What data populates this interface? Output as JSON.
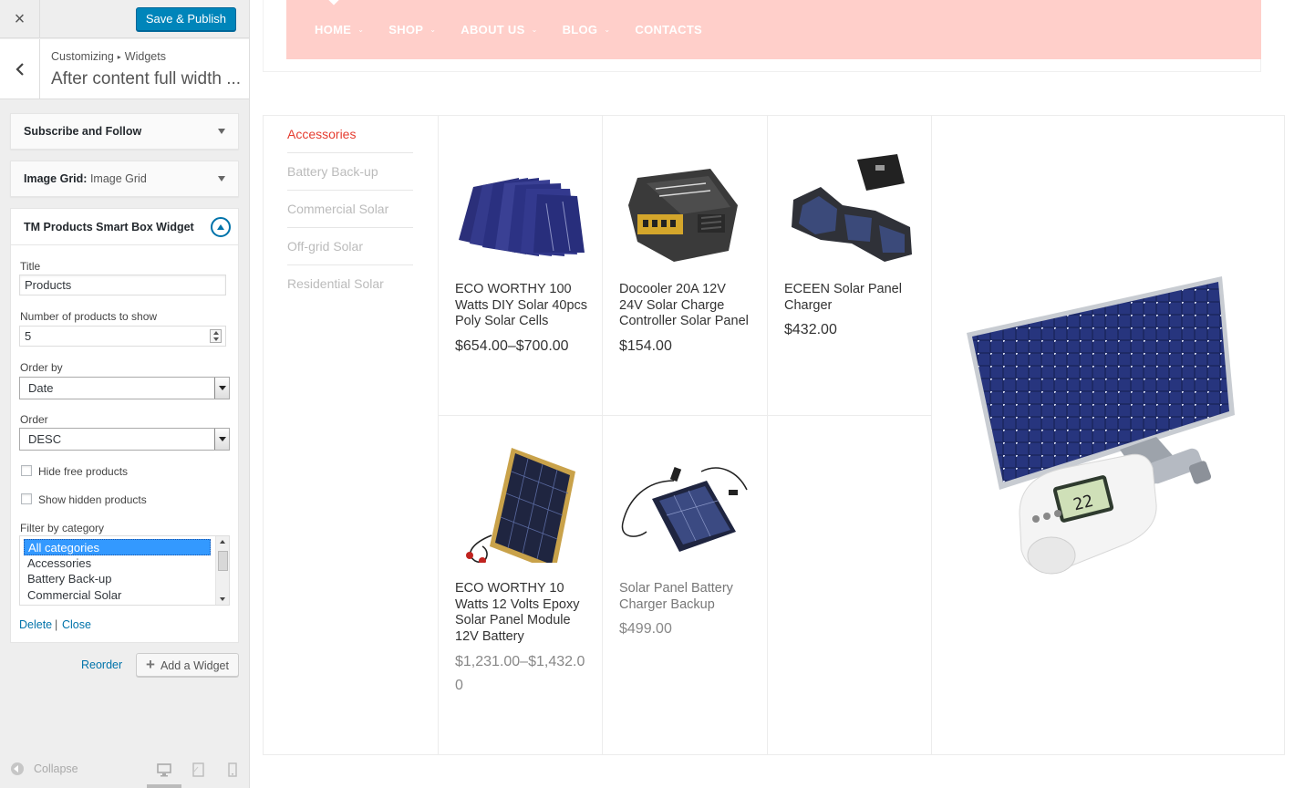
{
  "customizer": {
    "close_label": "×",
    "save_button": "Save & Publish",
    "breadcrumb": [
      "Customizing",
      "Widgets"
    ],
    "breadcrumb_sep": "▸",
    "section_title": "After content full width ...",
    "widgets": [
      {
        "title": "Subscribe and Follow",
        "subtitle": ""
      },
      {
        "title": "Image Grid:",
        "subtitle": "Image Grid"
      }
    ],
    "open_widget": {
      "title": "TM Products Smart Box Widget",
      "fields": {
        "title_label": "Title",
        "title_value": "Products",
        "count_label": "Number of products to show",
        "count_value": "5",
        "orderby_label": "Order by",
        "orderby_value": "Date",
        "order_label": "Order",
        "order_value": "DESC",
        "hide_free_label": "Hide free products",
        "show_hidden_label": "Show hidden products",
        "filter_label": "Filter by category",
        "categories": [
          "All categories",
          "Accessories",
          "Battery Back-up",
          "Commercial Solar"
        ]
      },
      "delete_label": "Delete",
      "link_sep": "|",
      "close_label": "Close"
    },
    "reorder_label": "Reorder",
    "add_widget_label": "Add a Widget",
    "collapse_label": "Collapse"
  },
  "site": {
    "nav": [
      "HOME",
      "SHOP",
      "ABOUT US",
      "BLOG",
      "CONTACTS"
    ],
    "nav_has_dropdown": [
      true,
      true,
      true,
      true,
      false
    ],
    "nav_caret": "⌄",
    "categories": [
      "Accessories",
      "Battery Back-up",
      "Commercial Solar",
      "Off-grid Solar",
      "Residential Solar"
    ],
    "products": [
      {
        "name": "ECO WORTHY 100 Watts DIY Solar 40pcs Poly Solar Cells",
        "price": "$654.00–$700.00"
      },
      {
        "name": "Docooler 20A 12V 24V Solar Charge Controller Solar Panel",
        "price": "$154.00"
      },
      {
        "name": "ECEEN Solar Panel Charger",
        "price": "$432.00"
      },
      {
        "name": "ECO WORTHY 10 Watts 12 Volts Epoxy Solar Panel Module 12V Battery",
        "price": "$1,231.00–$1,432.00"
      },
      {
        "name": "Solar Panel Battery Charger Backup",
        "price": "$499.00"
      }
    ]
  },
  "colors": {
    "accent": "#0085ba",
    "nav_bg": "#ffcfca",
    "active_category": "#e53d30"
  }
}
